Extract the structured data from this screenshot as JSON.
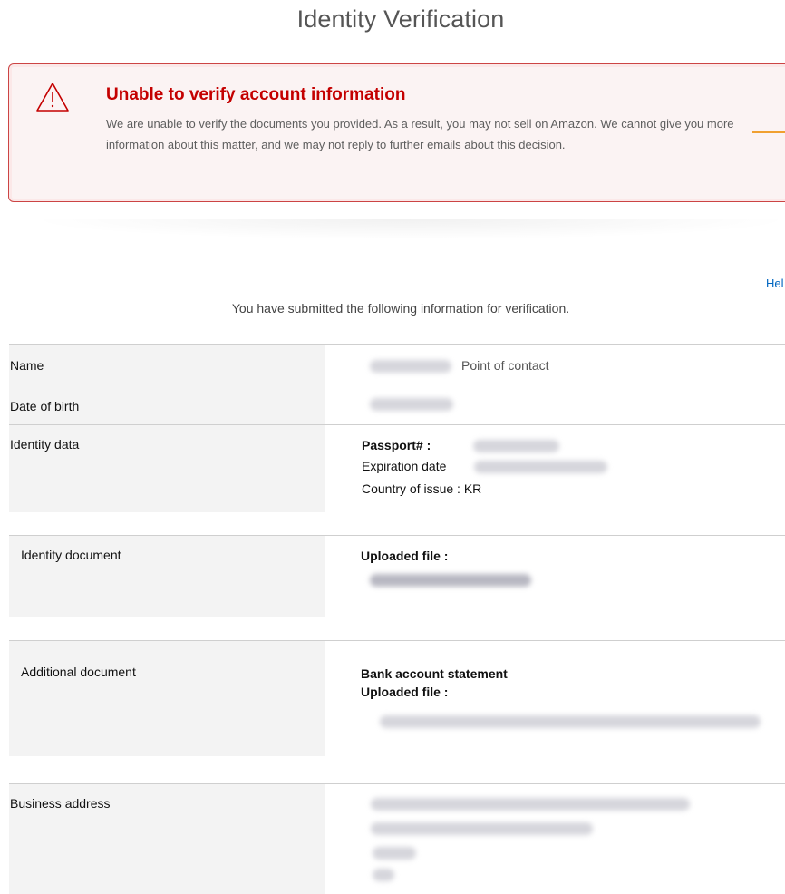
{
  "page": {
    "title": "Identity Verification"
  },
  "alert": {
    "icon": "warning-icon",
    "title": "Unable to verify account information",
    "body": "We are unable to verify the documents you provided. As a result, you may not sell on Amazon. We cannot give you more information about this matter, and we may not reply to further emails about this decision.",
    "colors": {
      "title": "#c40000",
      "border": "#cc4444",
      "background": "#fbf3f3"
    }
  },
  "help_link": {
    "label": "Hel"
  },
  "submitted_note": "You have submitted the following information for verification.",
  "personal": {
    "name_label": "Name",
    "point_of_contact": "Point of contact",
    "dob_label": "Date of birth"
  },
  "identity_data": {
    "label": "Identity data",
    "passport_label": "Passport# :",
    "expiration_label": "Expiration date",
    "country_label": "Country of issue : KR"
  },
  "identity_document": {
    "label": "Identity document",
    "uploaded_label": "Uploaded file :"
  },
  "additional_document": {
    "label": "Additional document",
    "doc_type": "Bank account statement",
    "uploaded_label": "Uploaded file :"
  },
  "business_address": {
    "label": "Business address"
  }
}
